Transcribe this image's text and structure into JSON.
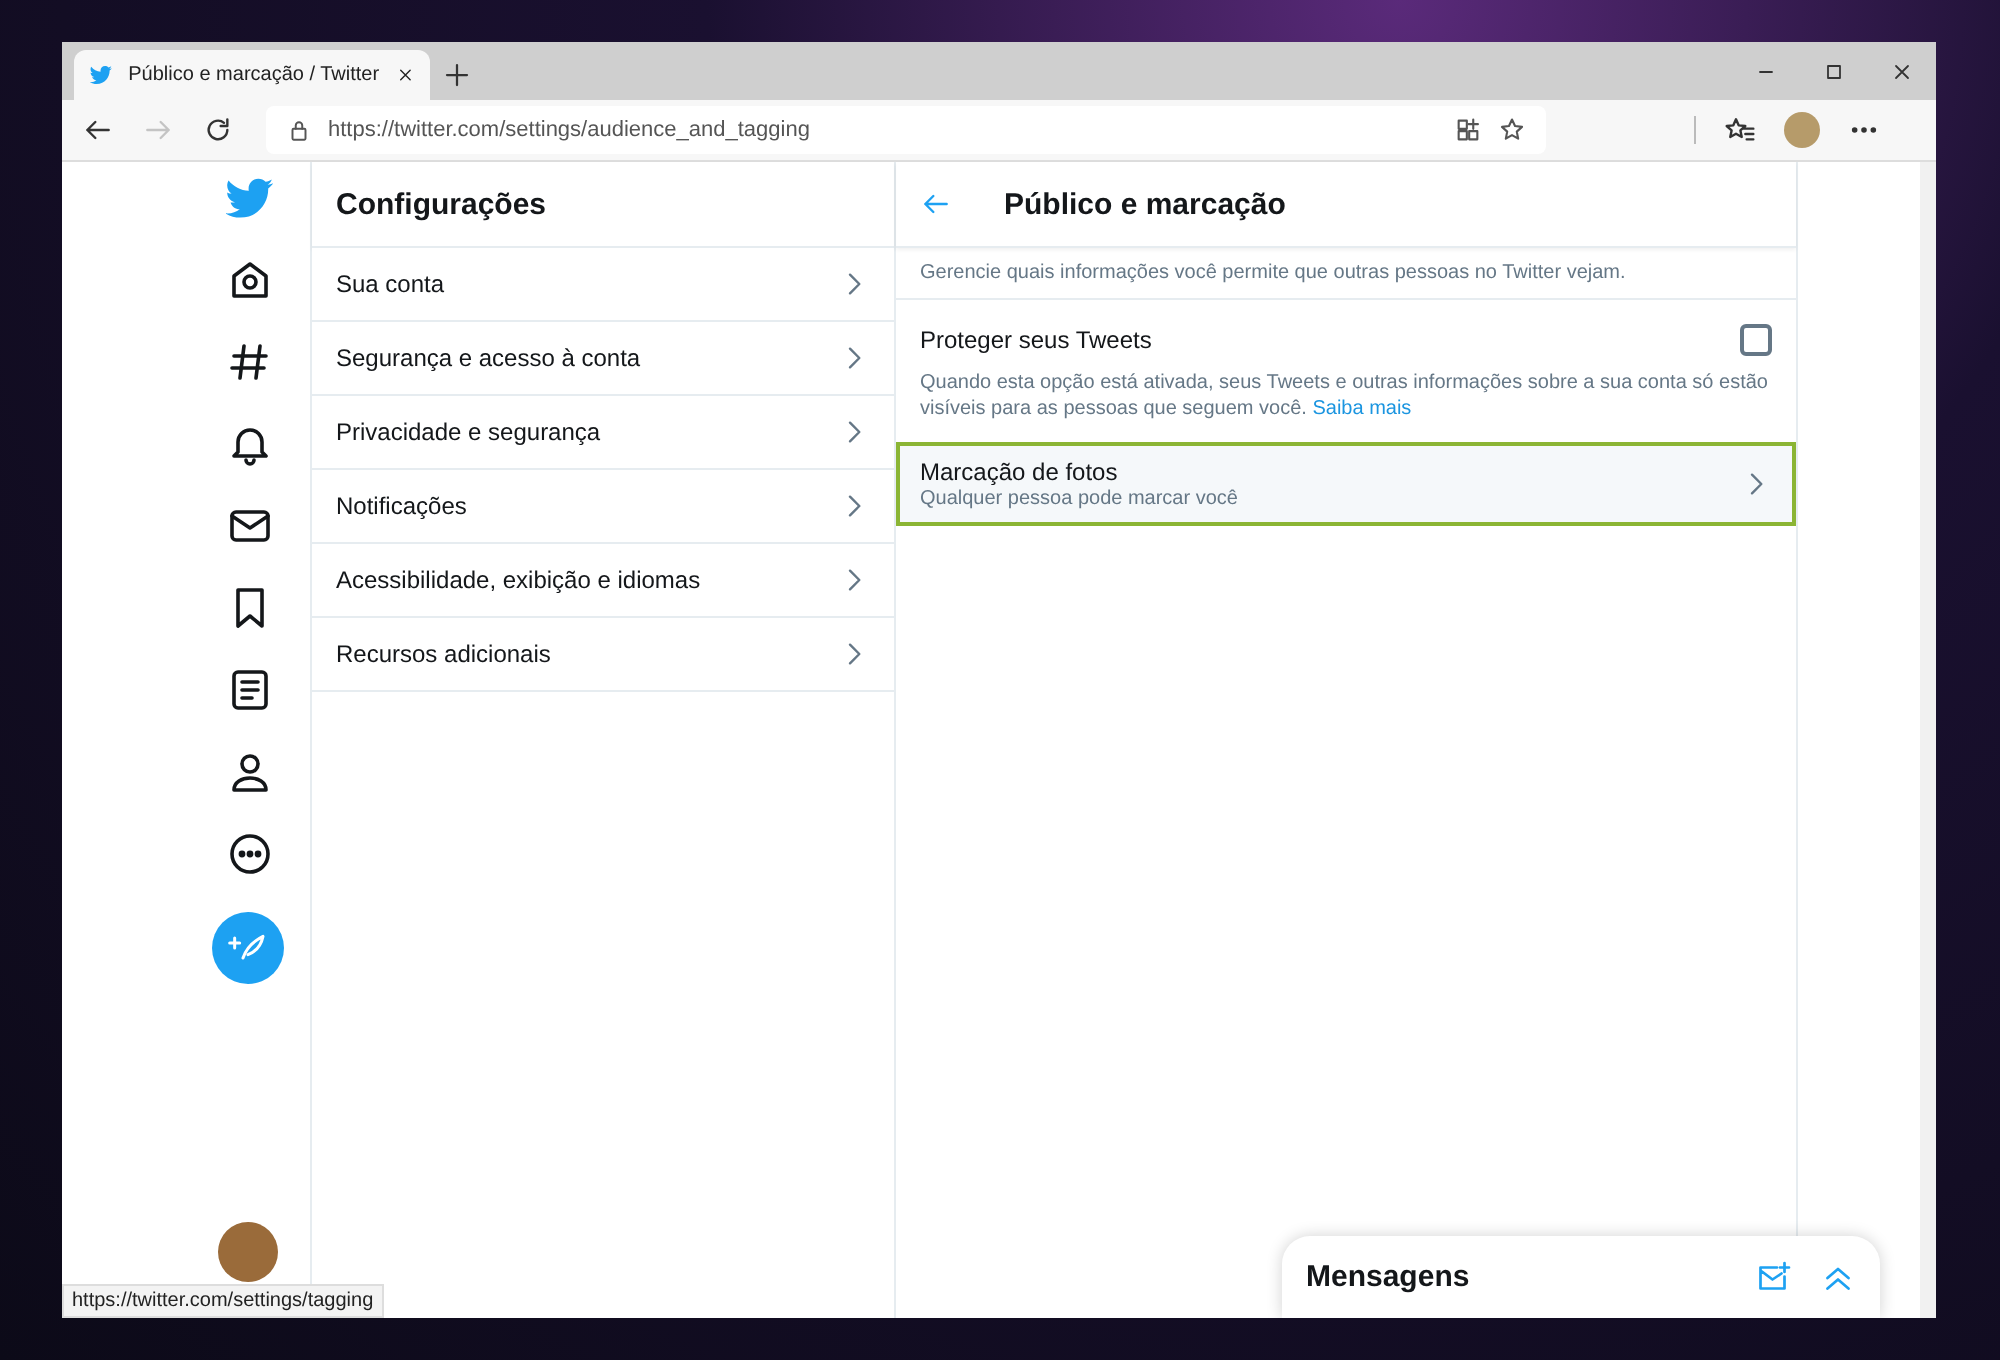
{
  "browser": {
    "tab": {
      "title": "Público e marcação / Twitter"
    },
    "url": "https://twitter.com/settings/audience_and_tagging",
    "status_url": "https://twitter.com/settings/tagging"
  },
  "settings": {
    "title": "Configurações",
    "items": [
      {
        "label": "Sua conta"
      },
      {
        "label": "Segurança e acesso à conta"
      },
      {
        "label": "Privacidade e segurança"
      },
      {
        "label": "Notificações"
      },
      {
        "label": "Acessibilidade, exibição e idiomas"
      },
      {
        "label": "Recursos adicionais"
      }
    ]
  },
  "detail": {
    "title": "Público e marcação",
    "intro": "Gerencie quais informações você permite que outras pessoas no Twitter vejam.",
    "options": [
      {
        "kind": "checkbox",
        "label": "Proteger seus Tweets",
        "checked": false,
        "description": "Quando esta opção está ativada, seus Tweets e outras informações sobre a sua conta só estão visíveis para as pessoas que seguem você.",
        "link": "Saiba mais"
      },
      {
        "kind": "link",
        "label": "Marcação de fotos",
        "value": "Qualquer pessoa pode marcar você",
        "focused": true
      }
    ]
  },
  "messages": {
    "title": "Mensagens"
  }
}
